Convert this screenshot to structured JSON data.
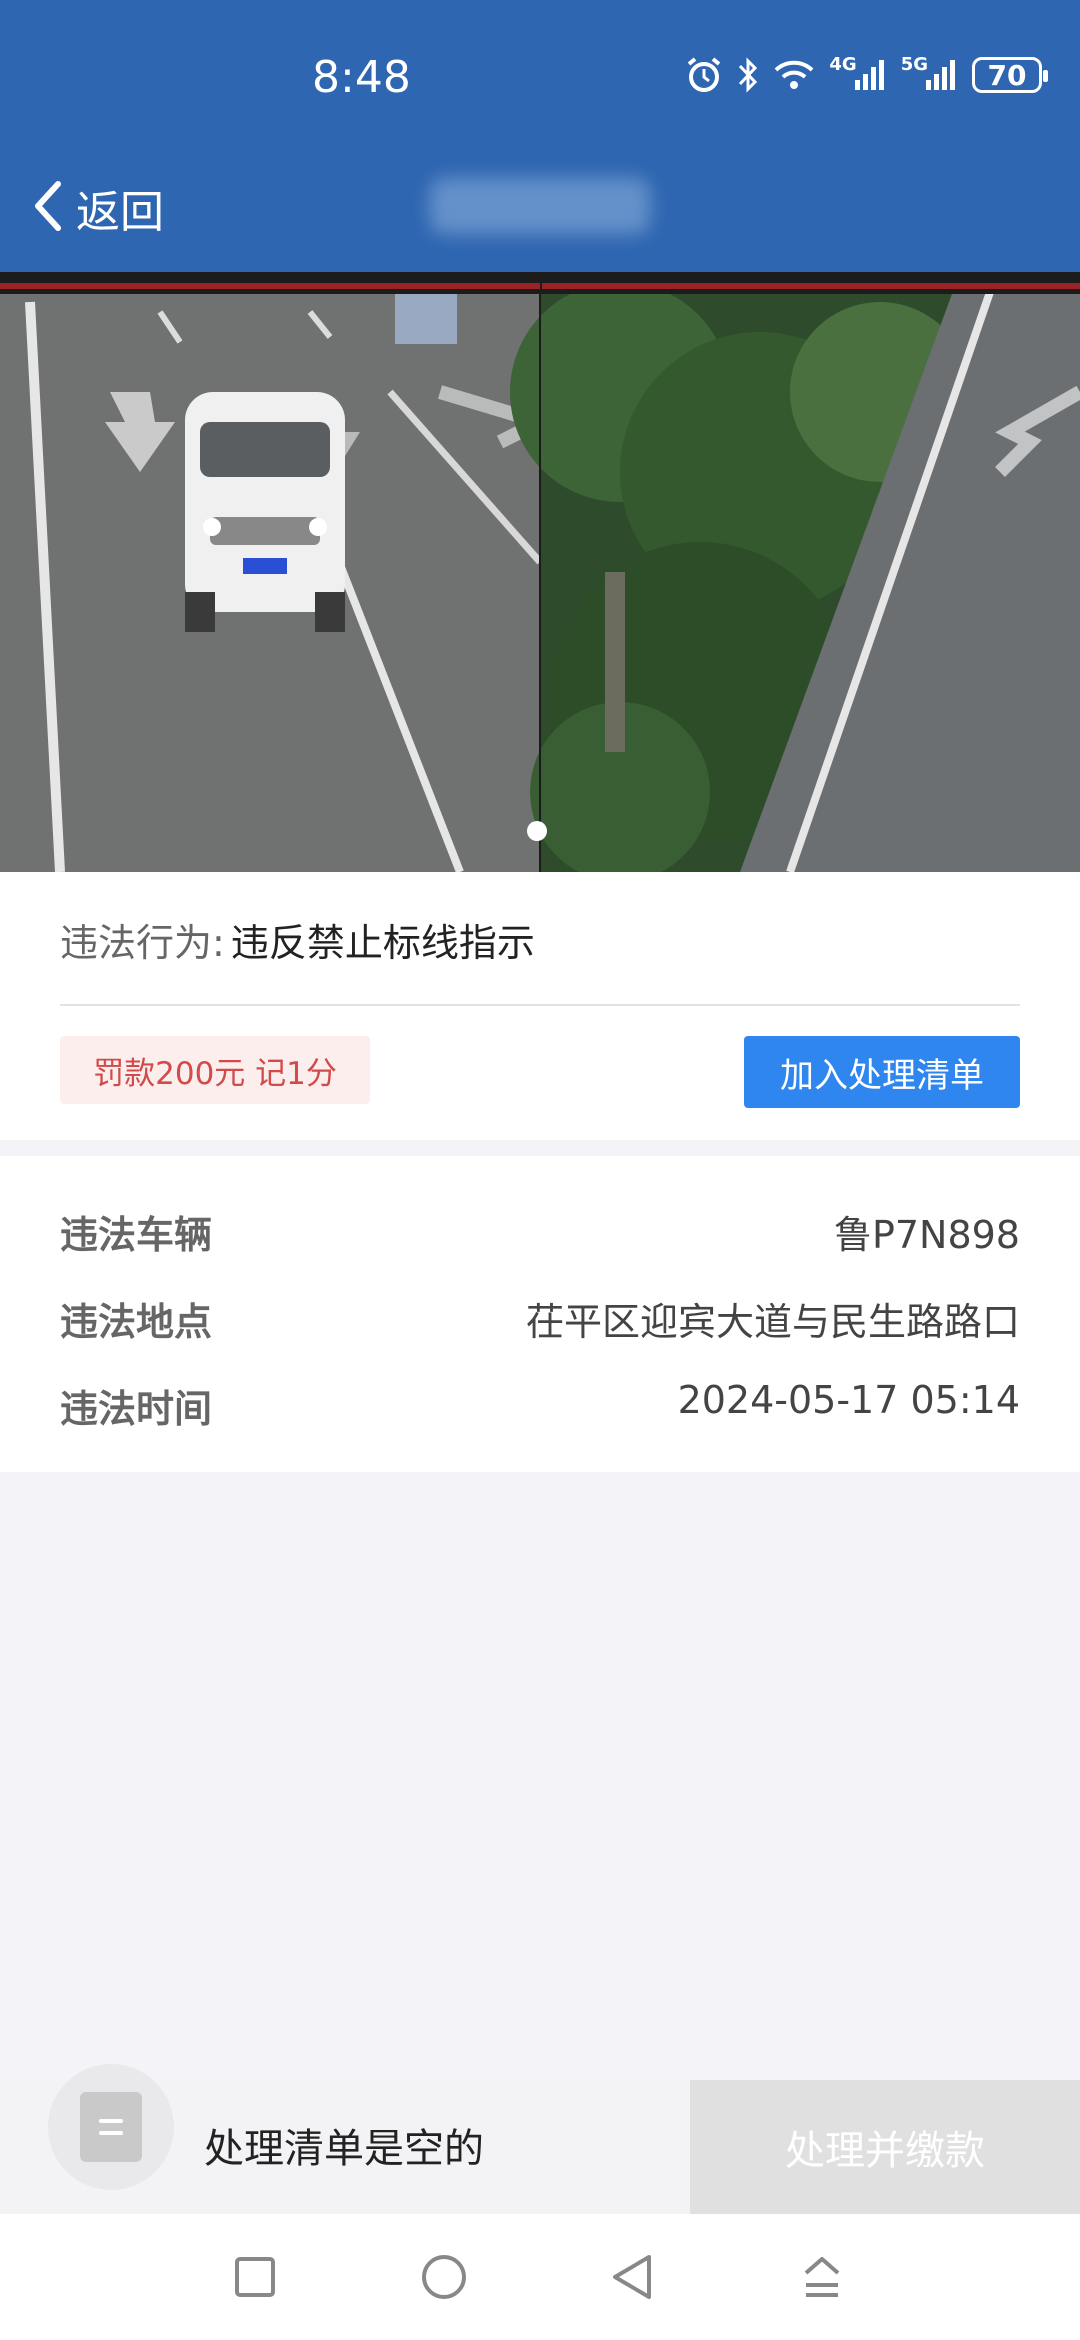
{
  "status_bar": {
    "time": "8:48",
    "signal_1": "4G",
    "signal_2": "5G",
    "battery": "70"
  },
  "header": {
    "back_label": "返回"
  },
  "violation": {
    "behavior_label": "违法行为:",
    "behavior_value": "违反禁止标线指示",
    "fine_badge": "罚款200元 记1分",
    "add_button": "加入处理清单"
  },
  "details": [
    {
      "label": "违法车辆",
      "value": "鲁P7N898"
    },
    {
      "label": "违法地点",
      "value": "茌平区迎宾大道与民生路路口"
    },
    {
      "label": "违法时间",
      "value": "2024-05-17 05:14"
    }
  ],
  "bottom": {
    "empty_text": "处理清单是空的",
    "pay_button": "处理并缴款"
  },
  "colors": {
    "header_bg": "#2f66b1",
    "primary_button": "#2f86ee",
    "fine_text": "#d24a4a",
    "fine_bg": "#fdeeee"
  }
}
